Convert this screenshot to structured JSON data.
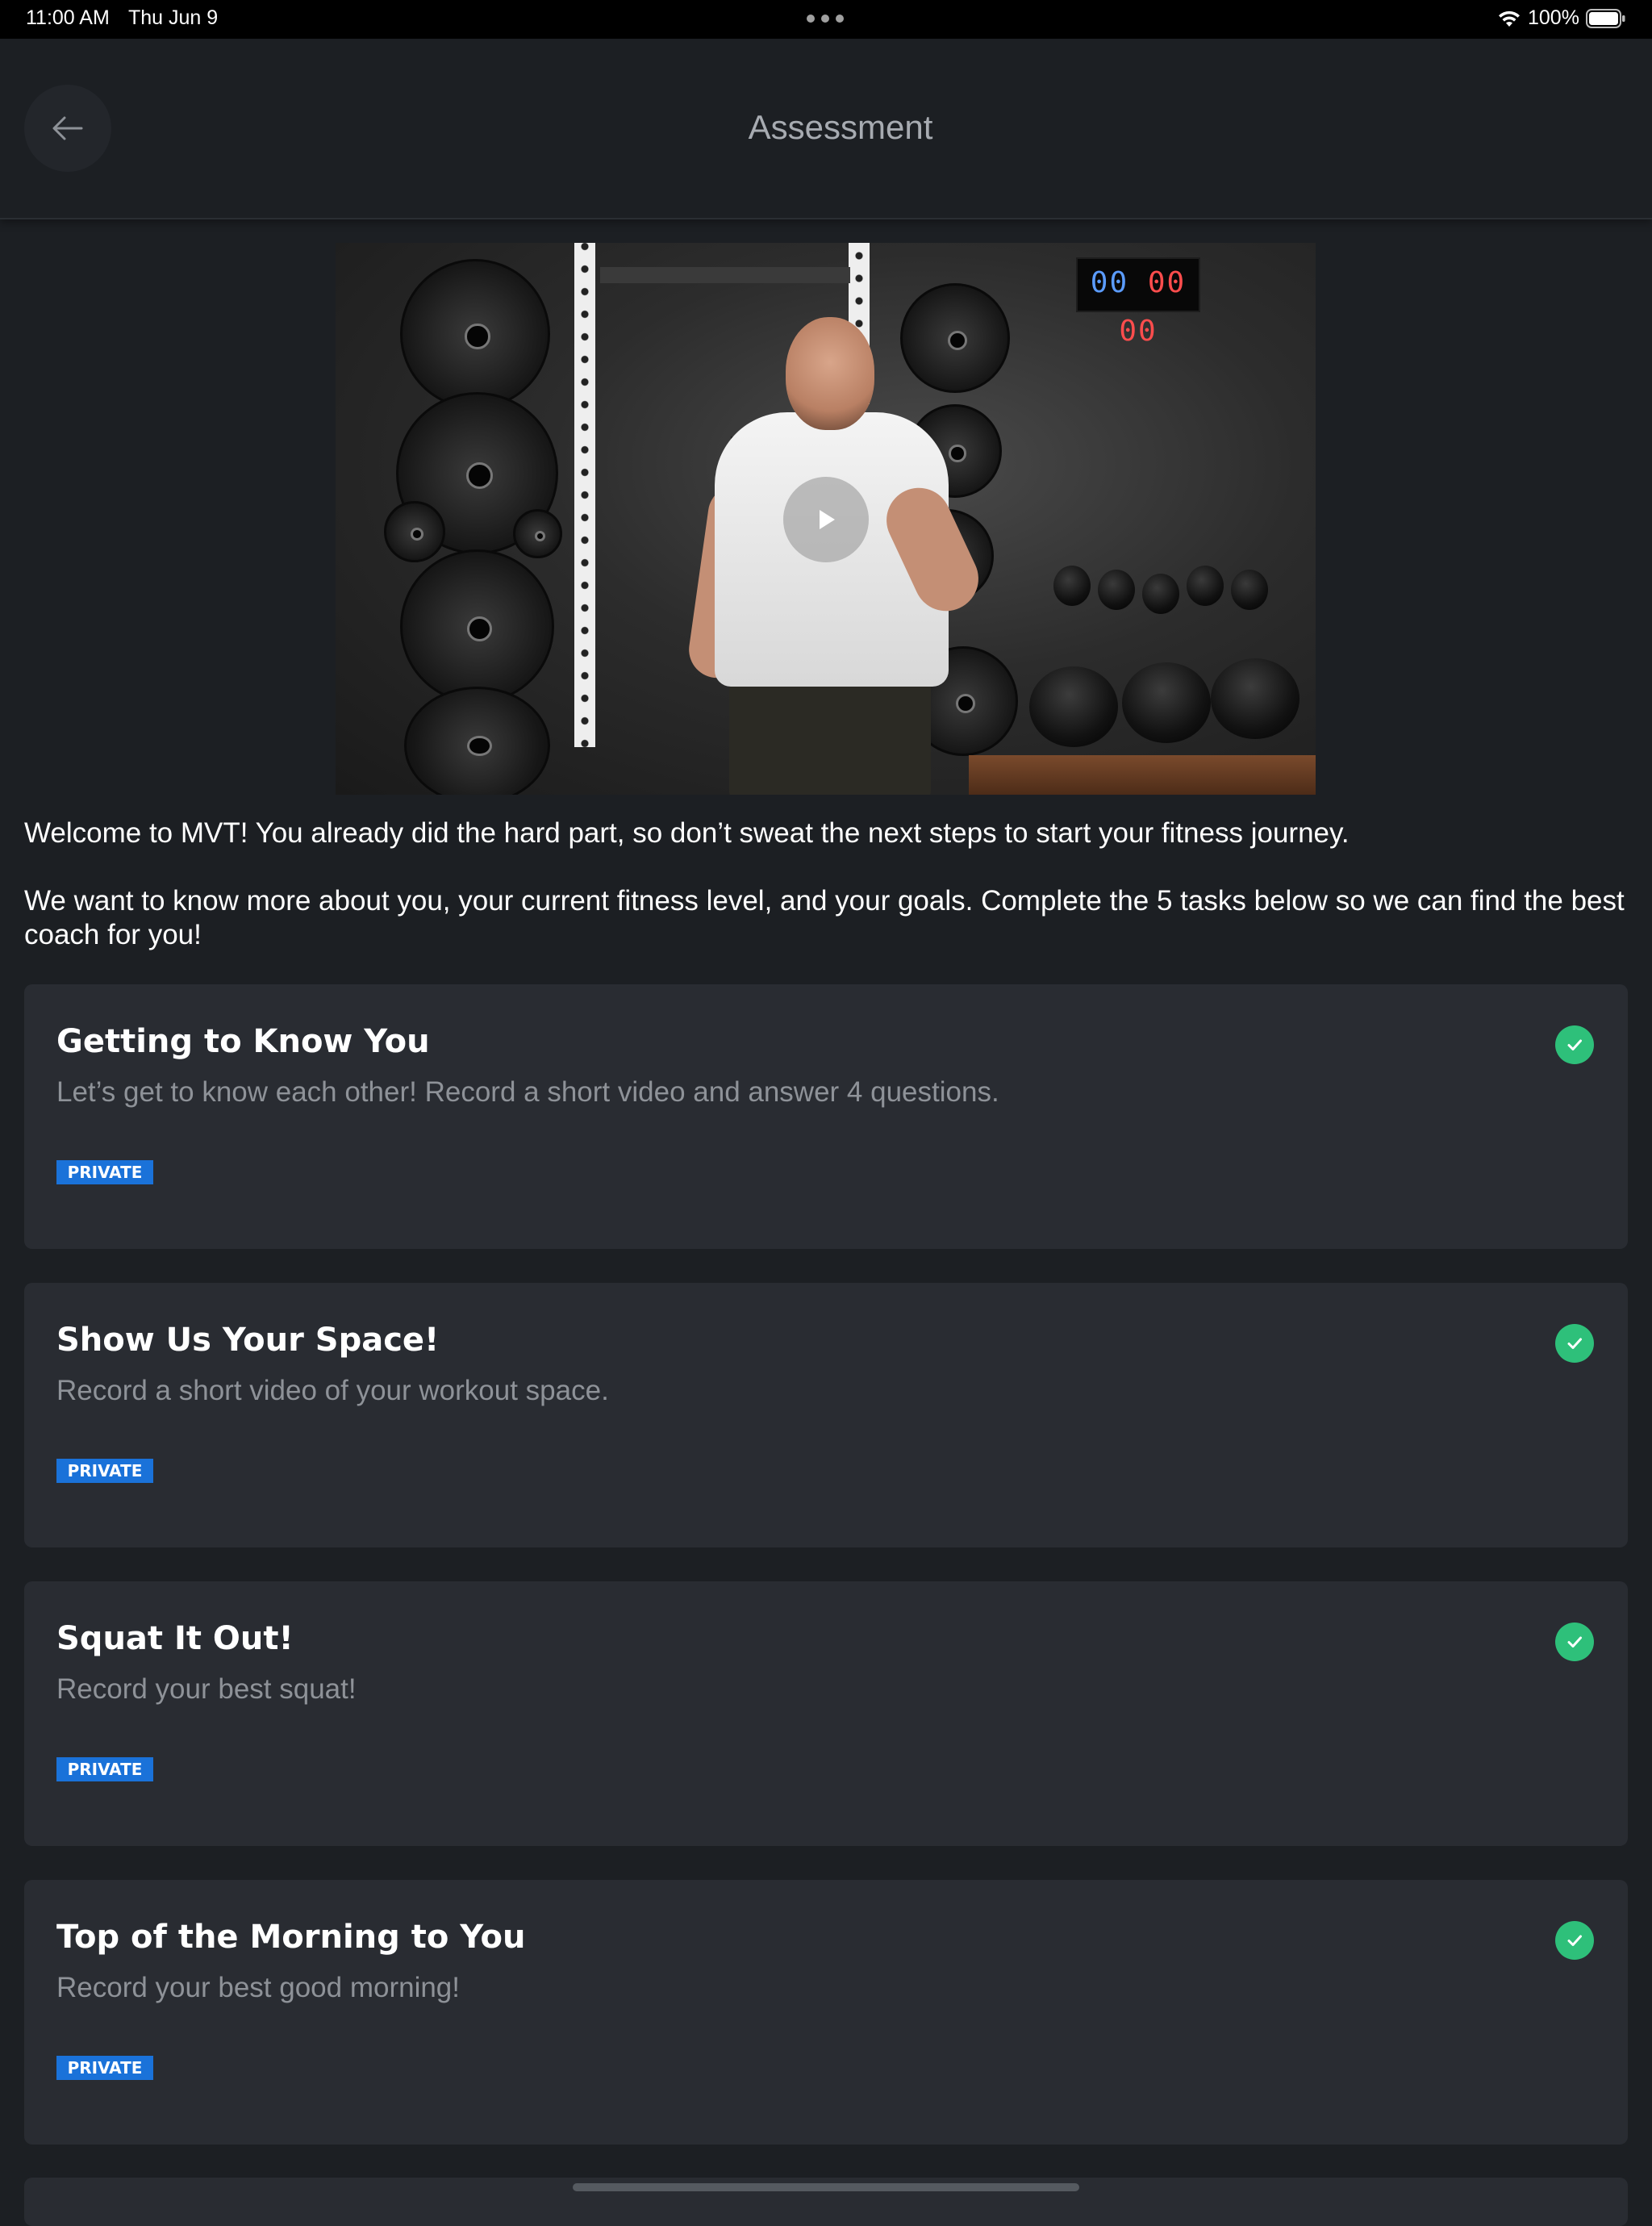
{
  "status_bar": {
    "time": "11:00 AM",
    "date": "Thu Jun 9",
    "battery": "100%"
  },
  "nav": {
    "title": "Assessment",
    "back_icon": "arrow-left-icon"
  },
  "video": {
    "timer": {
      "blue": "00",
      "red": "00 00"
    },
    "play_icon": "play-icon"
  },
  "intro": {
    "paragraph_1": "Welcome to MVT! You already did the hard part, so don’t sweat the next steps to start your fitness journey.",
    "paragraph_2": "We want to know more about you, your current fitness level, and your goals. Complete the 5 tasks below so we can find the best coach for you!"
  },
  "tasks": [
    {
      "title": "Getting to Know You",
      "description": "Let’s get to know each other! Record a short video and answer 4 questions.",
      "badge": "PRIVATE",
      "completed": true
    },
    {
      "title": "Show Us Your Space!",
      "description": "Record a short video of your workout space.",
      "badge": "PRIVATE",
      "completed": true
    },
    {
      "title": "Squat It Out!",
      "description": "Record your best squat!",
      "badge": "PRIVATE",
      "completed": true
    },
    {
      "title": "Top of the Morning to You",
      "description": "Record your best good morning!",
      "badge": "PRIVATE",
      "completed": true
    }
  ],
  "colors": {
    "background": "#1c1f23",
    "card": "#292c32",
    "badge": "#1a72d9",
    "check": "#2ec07a",
    "muted_text": "#8e9298"
  }
}
